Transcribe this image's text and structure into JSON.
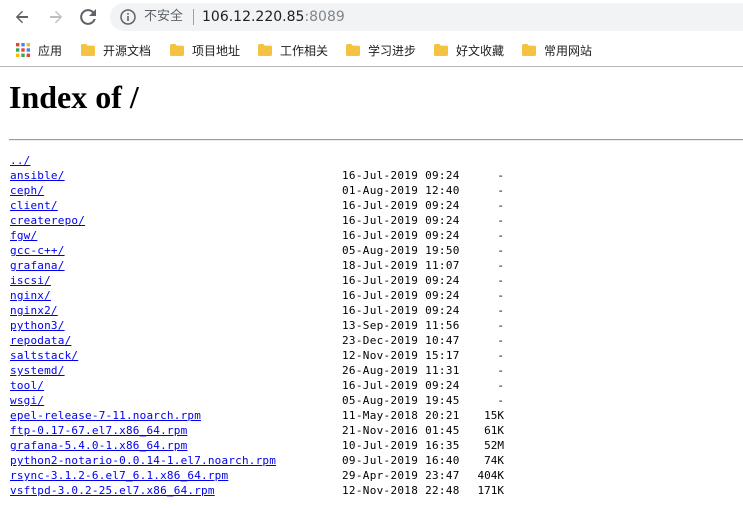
{
  "toolbar": {
    "back_icon": "arrow-left-icon",
    "forward_icon": "arrow-right-icon",
    "reload_icon": "reload-icon",
    "security_icon": "info-icon",
    "security_label": "不安全",
    "url_host": "106.12.220.85",
    "url_port": ":8089"
  },
  "bookmarks": {
    "items": [
      {
        "label": "应用",
        "icon": "apps-grid-icon"
      },
      {
        "label": "开源文档",
        "icon": "folder-icon"
      },
      {
        "label": "项目地址",
        "icon": "folder-icon"
      },
      {
        "label": "工作相关",
        "icon": "folder-icon"
      },
      {
        "label": "学习进步",
        "icon": "folder-icon"
      },
      {
        "label": "好文收藏",
        "icon": "folder-icon"
      },
      {
        "label": "常用网站",
        "icon": "folder-icon"
      }
    ]
  },
  "page": {
    "heading": "Index of /",
    "entries": [
      {
        "name": "../",
        "date": "",
        "size": ""
      },
      {
        "name": "ansible/",
        "date": "16-Jul-2019 09:24",
        "size": "-"
      },
      {
        "name": "ceph/",
        "date": "01-Aug-2019 12:40",
        "size": "-"
      },
      {
        "name": "client/",
        "date": "16-Jul-2019 09:24",
        "size": "-"
      },
      {
        "name": "createrepo/",
        "date": "16-Jul-2019 09:24",
        "size": "-"
      },
      {
        "name": "fgw/",
        "date": "16-Jul-2019 09:24",
        "size": "-"
      },
      {
        "name": "gcc-c++/",
        "date": "05-Aug-2019 19:50",
        "size": "-"
      },
      {
        "name": "grafana/",
        "date": "18-Jul-2019 11:07",
        "size": "-"
      },
      {
        "name": "iscsi/",
        "date": "16-Jul-2019 09:24",
        "size": "-"
      },
      {
        "name": "nginx/",
        "date": "16-Jul-2019 09:24",
        "size": "-"
      },
      {
        "name": "nginx2/",
        "date": "16-Jul-2019 09:24",
        "size": "-"
      },
      {
        "name": "python3/",
        "date": "13-Sep-2019 11:56",
        "size": "-"
      },
      {
        "name": "repodata/",
        "date": "23-Dec-2019 10:47",
        "size": "-"
      },
      {
        "name": "saltstack/",
        "date": "12-Nov-2019 15:17",
        "size": "-"
      },
      {
        "name": "systemd/",
        "date": "26-Aug-2019 11:31",
        "size": "-"
      },
      {
        "name": "tool/",
        "date": "16-Jul-2019 09:24",
        "size": "-"
      },
      {
        "name": "wsgi/",
        "date": "05-Aug-2019 19:45",
        "size": "-"
      },
      {
        "name": "epel-release-7-11.noarch.rpm",
        "date": "11-May-2018 20:21",
        "size": "15K"
      },
      {
        "name": "ftp-0.17-67.el7.x86_64.rpm",
        "date": "21-Nov-2016 01:45",
        "size": "61K"
      },
      {
        "name": "grafana-5.4.0-1.x86_64.rpm",
        "date": "10-Jul-2019 16:35",
        "size": "52M"
      },
      {
        "name": "python2-notario-0.0.14-1.el7.noarch.rpm",
        "date": "09-Jul-2019 16:40",
        "size": "74K"
      },
      {
        "name": "rsync-3.1.2-6.el7_6.1.x86_64.rpm",
        "date": "29-Apr-2019 23:47",
        "size": "404K"
      },
      {
        "name": "vsftpd-3.0.2-25.el7.x86_64.rpm",
        "date": "12-Nov-2018 22:48",
        "size": "171K"
      }
    ]
  }
}
